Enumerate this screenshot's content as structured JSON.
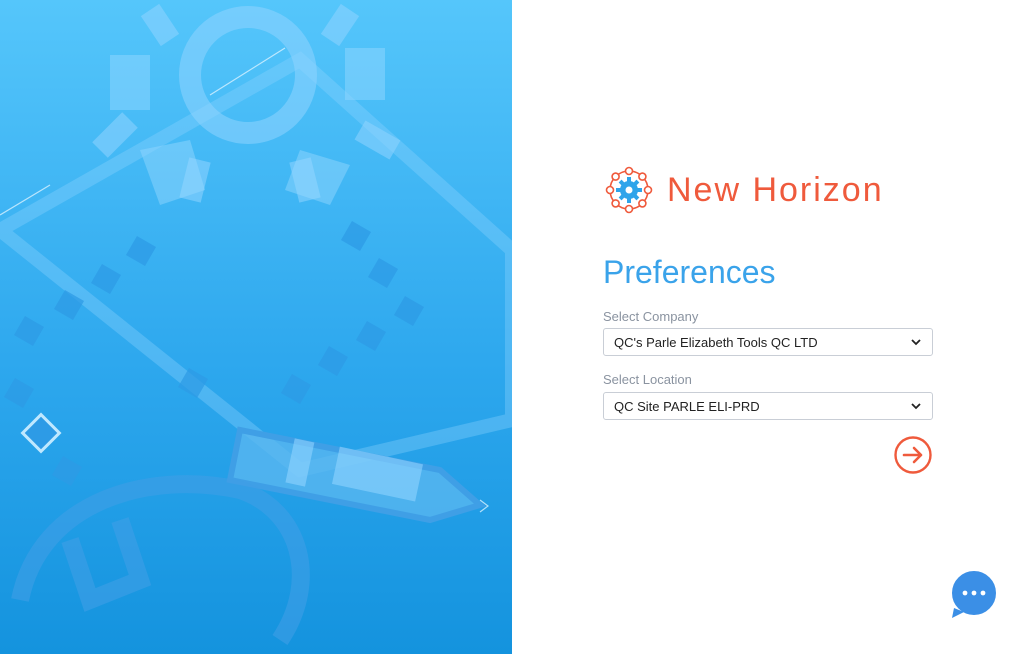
{
  "brand": {
    "name": "New Horizon",
    "icon": "gear-network-logo-icon",
    "color": "#ef5a3c"
  },
  "heading": "Preferences",
  "company": {
    "label": "Select Company",
    "value": "QC's Parle Elizabeth Tools QC LTD"
  },
  "location": {
    "label": "Select Location",
    "value": "QC Site PARLE ELI-PRD"
  },
  "actions": {
    "next_icon": "arrow-right-circle-icon",
    "chat_icon": "chat-bubble-icon"
  },
  "colors": {
    "accent_blue": "#3aa3ea",
    "accent_orange": "#ef5a3c",
    "chat_blue": "#3b8fe6"
  }
}
